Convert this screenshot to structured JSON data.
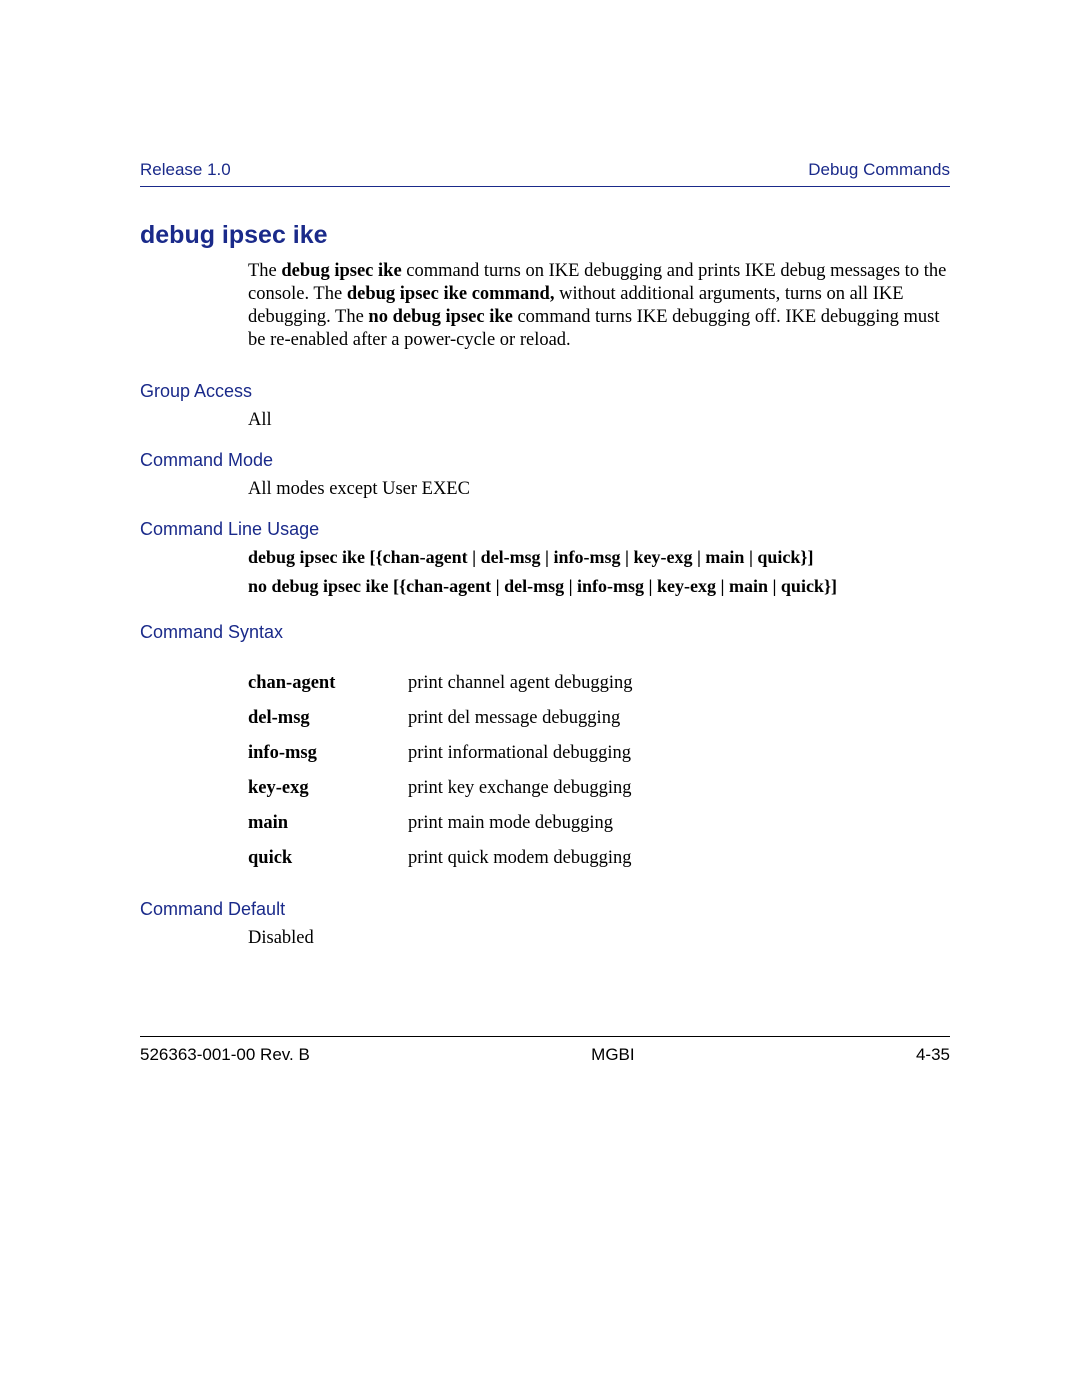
{
  "header": {
    "left": "Release 1.0",
    "right": "Debug Commands"
  },
  "title": "debug ipsec ike",
  "intro": {
    "p1_a": "The ",
    "p1_b": "debug ipsec ike",
    "p1_c": " command turns on IKE debugging and prints IKE debug messages to the console. The ",
    "p1_d": "debug ipsec ike command,",
    "p1_e": " without additional arguments, turns on all IKE debugging. The ",
    "p1_f": "no debug ipsec ike",
    "p1_g": " command turns IKE debugging off. IKE debugging must be re-enabled after a power-cycle or reload."
  },
  "sections": {
    "group_access": {
      "label": "Group Access",
      "body": "All"
    },
    "command_mode": {
      "label": "Command Mode",
      "body": "All modes except User EXEC"
    },
    "command_line_usage": {
      "label": "Command Line Usage",
      "line1": "debug ipsec ike [{chan-agent | del-msg | info-msg | key-exg | main | quick}]",
      "line2": "no debug ipsec ike [{chan-agent | del-msg | info-msg | key-exg | main | quick}]"
    },
    "command_syntax": {
      "label": "Command Syntax",
      "rows": [
        {
          "key": "chan-agent",
          "desc": "print channel agent debugging"
        },
        {
          "key": "del-msg",
          "desc": "print del message debugging"
        },
        {
          "key": "info-msg",
          "desc": "print informational debugging"
        },
        {
          "key": "key-exg",
          "desc": "print key exchange debugging"
        },
        {
          "key": "main",
          "desc": "print main mode debugging"
        },
        {
          "key": "quick",
          "desc": "print quick modem debugging"
        }
      ]
    },
    "command_default": {
      "label": "Command Default",
      "body": "Disabled"
    }
  },
  "footer": {
    "left": "526363-001-00 Rev. B",
    "center": "MGBI",
    "right": "4-35"
  }
}
